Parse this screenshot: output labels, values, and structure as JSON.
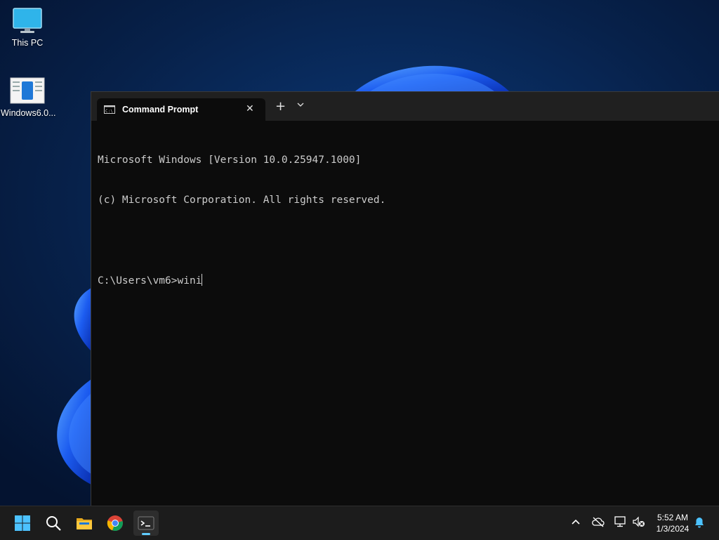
{
  "desktop": {
    "icons": [
      {
        "label": "This PC",
        "icon": "monitor-icon"
      },
      {
        "label": "Windows6.0...",
        "icon": "installer-icon"
      }
    ]
  },
  "terminal": {
    "tab": {
      "title": "Command Prompt",
      "icon": "cmd-icon",
      "close_glyph": "✕"
    },
    "new_tab_glyph": "+",
    "dropdown_icon": "chevron-down-icon",
    "console": {
      "lines": [
        "Microsoft Windows [Version 10.0.25947.1000]",
        "(c) Microsoft Corporation. All rights reserved.",
        ""
      ],
      "prompt": "C:\\Users\\vm6>",
      "input": "wini"
    }
  },
  "taskbar": {
    "items": [
      "start-icon",
      "search-icon",
      "file-explorer-icon",
      "chrome-icon",
      "terminal-icon"
    ],
    "tray": [
      "chevron-up-icon",
      "cloud-offline-icon",
      "network-icon",
      "volume-muted-icon",
      "notification-bell-icon"
    ],
    "clock": {
      "time": "5:52 AM",
      "date": "1/3/2024"
    }
  },
  "colors": {
    "terminal_bg": "#0c0c0c",
    "title_bar": "#202020",
    "taskbar": "#1c1c1c",
    "accent": "#60cdff"
  }
}
